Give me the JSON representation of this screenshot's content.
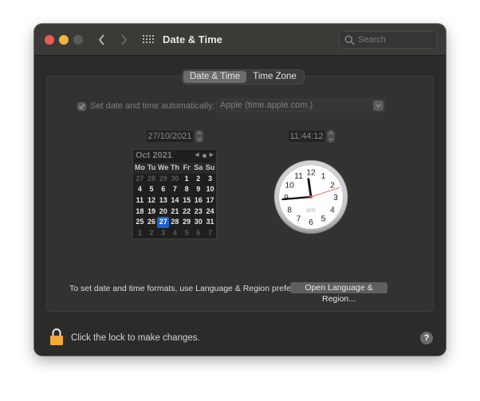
{
  "window": {
    "title": "Date & Time",
    "search_placeholder": "Search"
  },
  "tabs": [
    {
      "label": "Date & Time",
      "active": true
    },
    {
      "label": "Time Zone",
      "active": false
    }
  ],
  "auto": {
    "checked": true,
    "label": "Set date and time automatically:",
    "server": "Apple (time.apple.com.)"
  },
  "date_field": "27/10/2021",
  "time_field": "11:44:12",
  "calendar": {
    "month_label": "Oct 2021",
    "weekdays": [
      "Mo",
      "Tu",
      "We",
      "Th",
      "Fr",
      "Sa",
      "Su"
    ],
    "weeks": [
      [
        {
          "d": "27",
          "dim": true
        },
        {
          "d": "28",
          "dim": true
        },
        {
          "d": "29",
          "dim": true
        },
        {
          "d": "30",
          "dim": true
        },
        {
          "d": "1"
        },
        {
          "d": "2"
        },
        {
          "d": "3"
        }
      ],
      [
        {
          "d": "4"
        },
        {
          "d": "5"
        },
        {
          "d": "6"
        },
        {
          "d": "7"
        },
        {
          "d": "8"
        },
        {
          "d": "9"
        },
        {
          "d": "10"
        }
      ],
      [
        {
          "d": "11"
        },
        {
          "d": "12"
        },
        {
          "d": "13"
        },
        {
          "d": "14"
        },
        {
          "d": "15"
        },
        {
          "d": "16"
        },
        {
          "d": "17"
        }
      ],
      [
        {
          "d": "18"
        },
        {
          "d": "19"
        },
        {
          "d": "20"
        },
        {
          "d": "21"
        },
        {
          "d": "22"
        },
        {
          "d": "23"
        },
        {
          "d": "24"
        }
      ],
      [
        {
          "d": "25"
        },
        {
          "d": "26"
        },
        {
          "d": "27",
          "selected": true
        },
        {
          "d": "28"
        },
        {
          "d": "29"
        },
        {
          "d": "30"
        },
        {
          "d": "31"
        }
      ],
      [
        {
          "d": "1",
          "dim": true
        },
        {
          "d": "2",
          "dim": true
        },
        {
          "d": "3",
          "dim": true
        },
        {
          "d": "4",
          "dim": true
        },
        {
          "d": "5",
          "dim": true
        },
        {
          "d": "6",
          "dim": true
        },
        {
          "d": "7",
          "dim": true
        }
      ]
    ],
    "selected_color": "#1a63d6"
  },
  "clock": {
    "hours": 11,
    "minutes": 44,
    "seconds": 12,
    "period": "am",
    "numerals": [
      "12",
      "1",
      "2",
      "3",
      "4",
      "5",
      "6",
      "7",
      "8",
      "9",
      "10",
      "11"
    ],
    "second_hand_color": "#e8453c"
  },
  "formats": {
    "text": "To set date and time formats, use Language & Region preferences.",
    "button": "Open Language & Region..."
  },
  "footer": {
    "lock_text": "Click the lock to make changes.",
    "help_label": "?",
    "lock_color": "#f3a93a"
  }
}
